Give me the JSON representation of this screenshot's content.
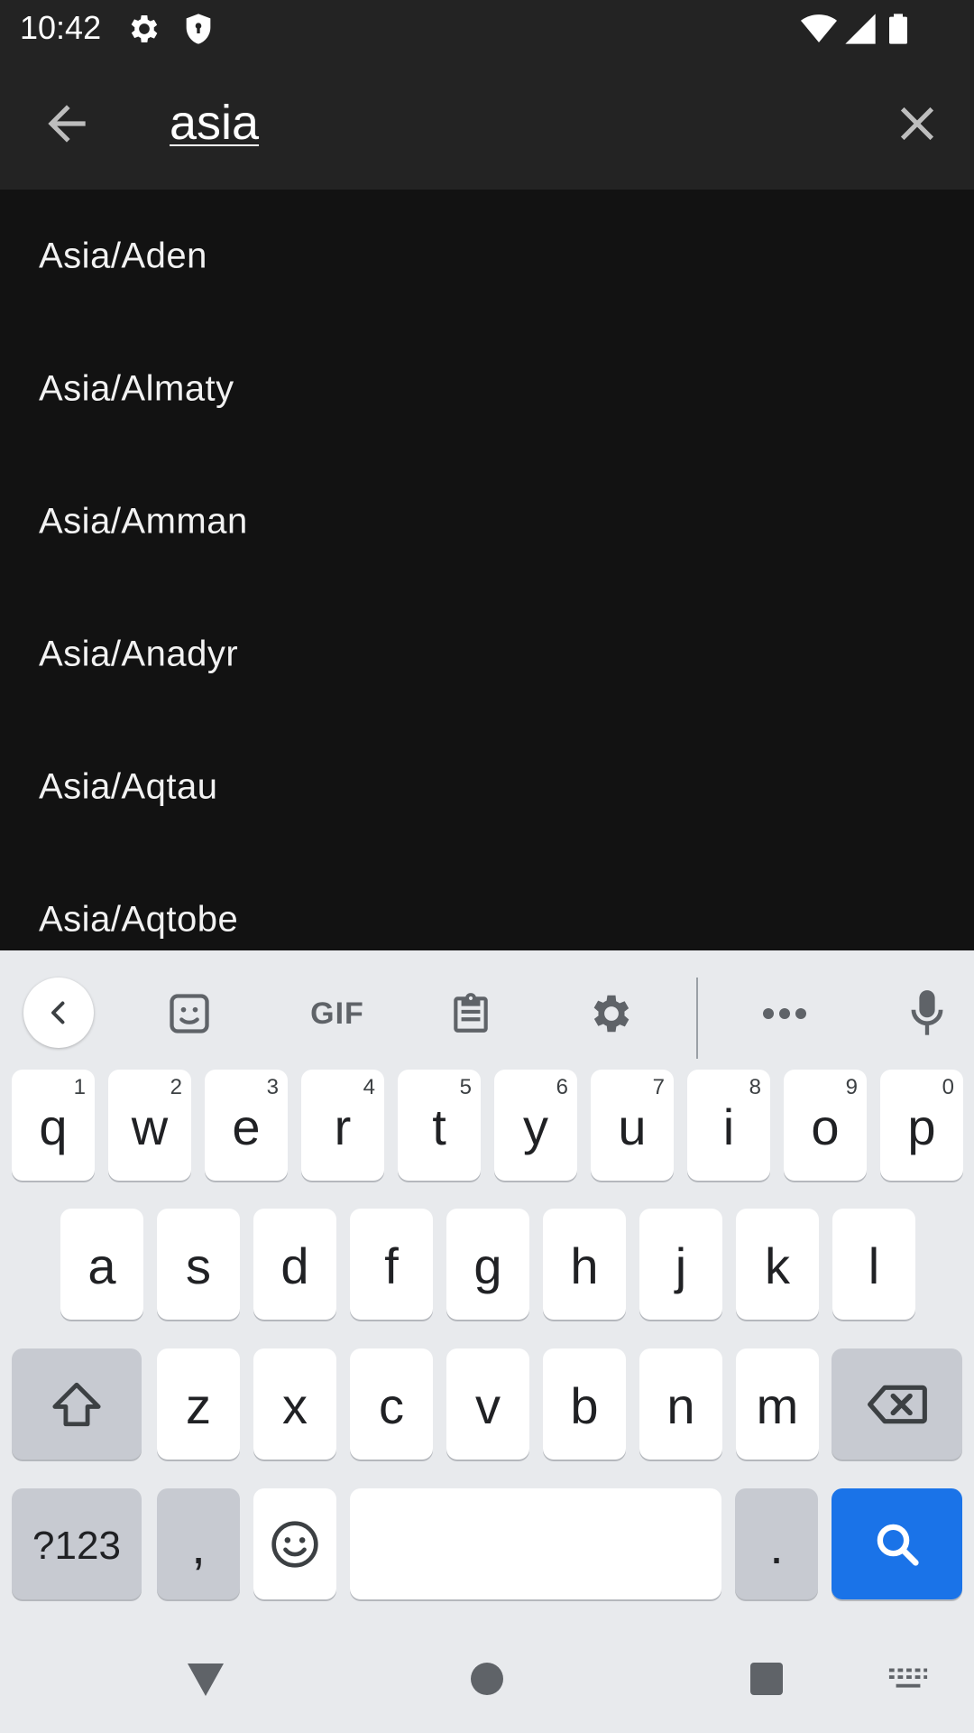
{
  "status_bar": {
    "time": "10:42",
    "icons": [
      "gear-icon",
      "shield-icon",
      "wifi-icon",
      "signal-icon",
      "battery-icon"
    ]
  },
  "toolbar": {
    "back_icon": "arrow-back-icon",
    "search_query": "asia",
    "clear_icon": "close-icon"
  },
  "results": [
    "Asia/Aden",
    "Asia/Almaty",
    "Asia/Amman",
    "Asia/Anadyr",
    "Asia/Aqtau",
    "Asia/Aqtobe"
  ],
  "keyboard": {
    "toolbar": [
      "chevron-left-icon",
      "sticker-icon",
      "gif-icon",
      "clipboard-icon",
      "settings-icon",
      "more-icon",
      "mic-icon"
    ],
    "gif_label": "GIF",
    "row1": [
      {
        "key": "q",
        "hint": "1"
      },
      {
        "key": "w",
        "hint": "2"
      },
      {
        "key": "e",
        "hint": "3"
      },
      {
        "key": "r",
        "hint": "4"
      },
      {
        "key": "t",
        "hint": "5"
      },
      {
        "key": "y",
        "hint": "6"
      },
      {
        "key": "u",
        "hint": "7"
      },
      {
        "key": "i",
        "hint": "8"
      },
      {
        "key": "o",
        "hint": "9"
      },
      {
        "key": "p",
        "hint": "0"
      }
    ],
    "row2": [
      "a",
      "s",
      "d",
      "f",
      "g",
      "h",
      "j",
      "k",
      "l"
    ],
    "row3": [
      "z",
      "x",
      "c",
      "v",
      "b",
      "n",
      "m"
    ],
    "symbols_label": "?123",
    "comma_label": ",",
    "period_label": ".",
    "colors": {
      "background": "#e8eaed",
      "key": "#ffffff",
      "special_key": "#c7cad1",
      "action_key": "#1a73e8"
    }
  },
  "nav_bar": {
    "icons": [
      "back-triangle-icon",
      "home-circle-icon",
      "recents-square-icon",
      "keyboard-switch-icon"
    ]
  },
  "colors": {
    "app_bar": "#232323",
    "list_background": "#121212",
    "text": "#ffffff"
  }
}
